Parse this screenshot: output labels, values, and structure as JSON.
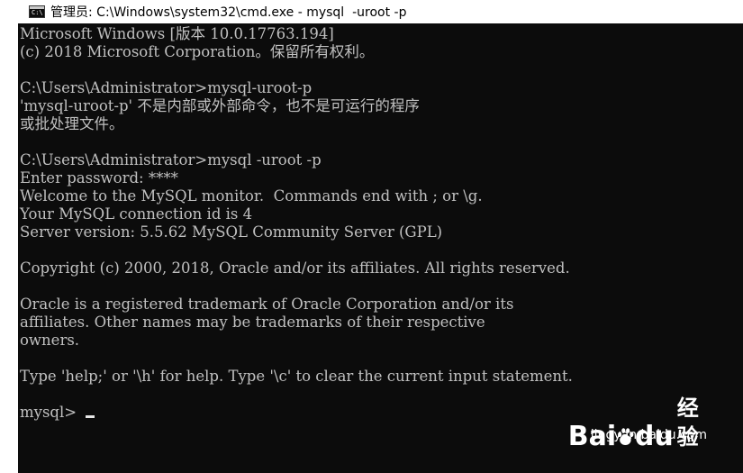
{
  "window": {
    "title": "管理员: C:\\Windows\\system32\\cmd.exe - mysql  -uroot -p",
    "icon": "cmd-icon",
    "icon_text": "C:\\"
  },
  "console": {
    "lines": [
      "Microsoft Windows [版本 10.0.17763.194]",
      "(c) 2018 Microsoft Corporation。保留所有权利。",
      "",
      "C:\\Users\\Administrator>mysql-uroot-p",
      "'mysql-uroot-p' 不是内部或外部命令，也不是可运行的程序",
      "或批处理文件。",
      "",
      "C:\\Users\\Administrator>mysql -uroot -p",
      "Enter password: ****",
      "Welcome to the MySQL monitor.  Commands end with ; or \\g.",
      "Your MySQL connection id is 4",
      "Server version: 5.5.62 MySQL Community Server (GPL)",
      "",
      "Copyright (c) 2000, 2018, Oracle and/or its affiliates. All rights reserved.",
      "",
      "Oracle is a registered trademark of Oracle Corporation and/or its",
      "affiliates. Other names may be trademarks of their respective",
      "owners.",
      "",
      "Type 'help;' or '\\h' for help. Type '\\c' to clear the current input statement.",
      ""
    ],
    "prompt": "mysql>"
  },
  "watermark": {
    "brand_bai": "Bai",
    "brand_du": "du",
    "brand_jy": "经验",
    "url": "jingyan.baidu.com"
  },
  "colors": {
    "console_bg": "#0c0c0c",
    "console_text": "#c0c0c0",
    "titlebar_bg": "#ffffff"
  }
}
